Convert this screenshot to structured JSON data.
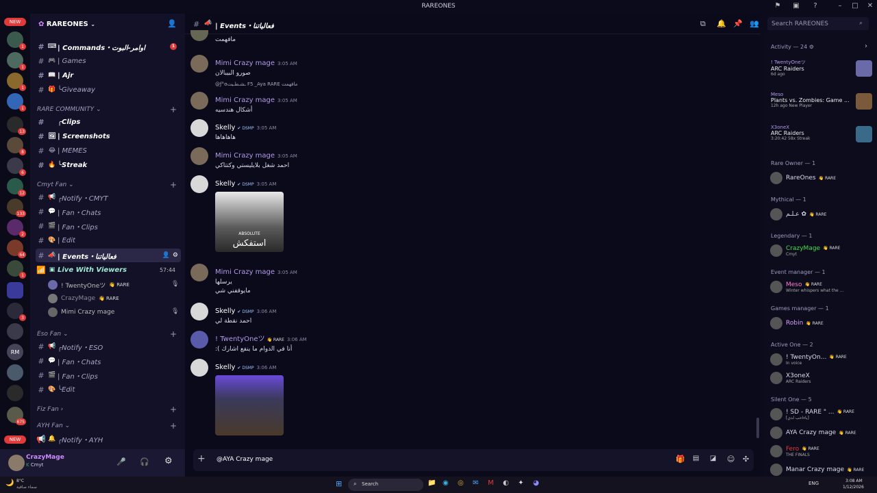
{
  "window": {
    "title": "RAREONES"
  },
  "guild_badges": {
    "new_top": "NEW",
    "new_bottom": "NEW",
    "rm": "RM",
    "counts": [
      "1",
      "1",
      "1",
      "1",
      "13",
      "8",
      "6",
      "12",
      "133",
      "2",
      "64",
      "1",
      "3",
      "675"
    ]
  },
  "server": {
    "name": "RAREONES"
  },
  "channels_top": [
    {
      "emoji": "⌨",
      "label": "| Commands・اوامر-البوت",
      "bold": true,
      "badge": "1"
    },
    {
      "emoji": "🎮",
      "label": "| Games",
      "bold": false
    },
    {
      "emoji": "📖",
      "label": "| Ajr",
      "bold": true
    },
    {
      "emoji": "🎁",
      "label": "╰Giveaway",
      "bold": false
    }
  ],
  "cat_rare": {
    "label": "RARE COMMUNITY"
  },
  "channels_rare": [
    {
      "emoji": "",
      "label": "╭Clips",
      "bold": true
    },
    {
      "emoji": "🖼",
      "label": "| Screenshots",
      "bold": true
    },
    {
      "emoji": "😂",
      "label": "| MEMES",
      "bold": false
    },
    {
      "emoji": "🔥",
      "label": "╰Streak",
      "bold": true
    }
  ],
  "cat_cmyt": {
    "label": "Cmyt Fan"
  },
  "channels_cmyt": [
    {
      "emoji": "📢",
      "label": "╭Notify・CMYT"
    },
    {
      "emoji": "💬",
      "label": "| Fan・Chats"
    },
    {
      "emoji": "🎬",
      "label": "| Fan・Clips"
    },
    {
      "emoji": "🎨",
      "label": "| Edit"
    }
  ],
  "selected_channel": {
    "label": "| Events・فعالياتنا"
  },
  "voice_channel": {
    "label": "Live With Viewers",
    "timer": "57:44"
  },
  "voice_users": [
    {
      "name": "! TwentyOneツ",
      "tag": "RARE"
    },
    {
      "name": "CrazyMage",
      "tag": "RARE"
    },
    {
      "name": "Mimi Crazy mage",
      "tag": ""
    }
  ],
  "cat_eso": {
    "label": "Eso Fan"
  },
  "channels_eso": [
    {
      "emoji": "📢",
      "label": "╭Notify・ESO"
    },
    {
      "emoji": "💬",
      "label": "| Fan・Chats"
    },
    {
      "emoji": "🎬",
      "label": "| Fan・Clips"
    },
    {
      "emoji": "🎨",
      "label": "╰Edit"
    }
  ],
  "cat_fiz": {
    "label": "Fiz Fan"
  },
  "cat_ayh": {
    "label": "AYH Fan"
  },
  "channel_ayh": {
    "label": "╭Notify・AYH"
  },
  "user": {
    "name": "CrazyMage",
    "status": "Cmyt"
  },
  "chat": {
    "header": "| Events・فعالياتنا",
    "search_placeholder": "Search RAREONES",
    "composer_value": "@AYA Crazy mage",
    "top_partial": "مافهمت",
    "messages": [
      {
        "name": "Mimi Crazy mage",
        "time": "3:05 AM",
        "tag": "",
        "body": "صورو البيبالان"
      },
      {
        "name": "Mimi Crazy mage",
        "time": "3:05 AM",
        "tag": "",
        "reply": "@ƒ°ɞـشـطـيت F5 _Aya  RARE  مافهمت",
        "body": "أشكال هندسيه"
      },
      {
        "name": "Skelly",
        "time": "3:05 AM",
        "tag": "DSMP",
        "body": "هاهاهاها"
      },
      {
        "name": "Mimi Crazy mage",
        "time": "3:05 AM",
        "tag": "",
        "body": "احمد شغل بلايليستي وكتتاكي"
      },
      {
        "name": "Skelly",
        "time": "3:05 AM",
        "tag": "DSMP",
        "body": "",
        "image": {
          "line1": "ABSOLUTE",
          "line2": "استفكش"
        }
      },
      {
        "name": "Mimi Crazy mage",
        "time": "3:05 AM",
        "tag": "",
        "body": "يرسلها",
        "body2": "مايوقفني شي"
      },
      {
        "name": "Skelly",
        "time": "3:06 AM",
        "tag": "DSMP",
        "body": "احمد نقطة لي"
      },
      {
        "name": "! TwentyOneツ",
        "time": "3:06 AM",
        "tag": "RARE",
        "body": "أنا في الدوام ما ينفع اشارك ):"
      },
      {
        "name": "Skelly",
        "time": "3:06 AM",
        "tag": "DSMP",
        "body": "",
        "image2": true
      }
    ]
  },
  "members": {
    "activity": "Activity — 24",
    "activities": [
      {
        "user": "! TwentyOneツ",
        "game": "ARC Raiders",
        "sub": "6d ago"
      },
      {
        "user": "Meso",
        "game": "Plants vs. Zombies: Game ...",
        "sub": "12h ago  New Player"
      },
      {
        "user": "X3oneX",
        "game": "ARC Raiders",
        "sub": "3:20:42  58x Streak"
      }
    ],
    "groups": [
      {
        "label": "Rare Owner — 1",
        "items": [
          {
            "name": "RareOnes",
            "tag": "RARE",
            "sub": ""
          }
        ]
      },
      {
        "label": "Mythical — 1",
        "items": [
          {
            "name": "عـلـم ✿",
            "tag": "RARE",
            "sub": ""
          }
        ]
      },
      {
        "label": "Legendary — 1",
        "items": [
          {
            "name": "CrazyMage",
            "tag": "RARE",
            "sub": "Cmyt"
          }
        ]
      },
      {
        "label": "Event manager — 1",
        "items": [
          {
            "name": "Meso",
            "tag": "RARE",
            "sub": "Winter whispers what the ..."
          }
        ]
      },
      {
        "label": "Games manager — 1",
        "items": [
          {
            "name": "Robin",
            "tag": "RARE",
            "sub": ""
          }
        ]
      },
      {
        "label": "Active One — 2",
        "items": [
          {
            "name": "! TwentyOn...",
            "tag": "RARE",
            "sub": "In voice"
          },
          {
            "name": "X3oneX",
            "tag": "",
            "sub": "ARC Raiders"
          }
        ]
      },
      {
        "label": "Silent One — 5",
        "items": [
          {
            "name": "! SD - RARE \" ...",
            "tag": "RARE",
            "sub": "[ياءاحب لدي]"
          },
          {
            "name": "AYA Crazy mage",
            "tag": "RARE",
            "sub": ""
          },
          {
            "name": "Fero",
            "tag": "RARE",
            "sub": "THE FINALS"
          },
          {
            "name": "Manar Crazy mage",
            "tag": "RARE",
            "sub": ""
          }
        ]
      }
    ]
  },
  "taskbar": {
    "search": "Search",
    "weather": "8°C",
    "weather_sub": "سماء صافية",
    "lang": "ENG",
    "time": "3:08 AM",
    "date": "1/12/2026"
  },
  "colors": {
    "accent": "#5865f2",
    "bg": "#0a0a1a",
    "badge": "#e03a3a",
    "green": "#3ba55d"
  }
}
